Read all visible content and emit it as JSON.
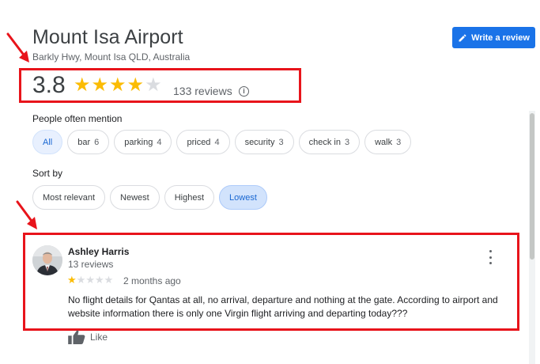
{
  "place": {
    "title": "Mount Isa Airport",
    "address": "Barkly Hwy, Mount Isa QLD, Australia"
  },
  "write_review": {
    "label": "Write a review",
    "icon": "pencil-icon"
  },
  "rating": {
    "value": "3.8",
    "stars_filled": 4,
    "stars_total": 5,
    "reviews_count": "133 reviews",
    "info_icon": "info-icon"
  },
  "mentions": {
    "label": "People often mention",
    "chips": [
      {
        "label": "All",
        "count": ""
      },
      {
        "label": "bar",
        "count": "6"
      },
      {
        "label": "parking",
        "count": "4"
      },
      {
        "label": "priced",
        "count": "4"
      },
      {
        "label": "security",
        "count": "3"
      },
      {
        "label": "check in",
        "count": "3"
      },
      {
        "label": "walk",
        "count": "3"
      }
    ],
    "active": "All"
  },
  "sort": {
    "label": "Sort by",
    "options": [
      "Most relevant",
      "Newest",
      "Highest",
      "Lowest"
    ],
    "active": "Lowest"
  },
  "review": {
    "author": "Ashley Harris",
    "meta": "13 reviews",
    "stars_filled": 1,
    "stars_total": 5,
    "date": "2 months ago",
    "text": "No flight details for Qantas at all, no arrival, departure and nothing at the gate. According to airport and website information there is only one Virgin flight arriving and departing today???",
    "like_label": "Like"
  },
  "colors": {
    "accent": "#1a73e8",
    "star": "#fbbc04",
    "annotation": "#e8141b"
  }
}
